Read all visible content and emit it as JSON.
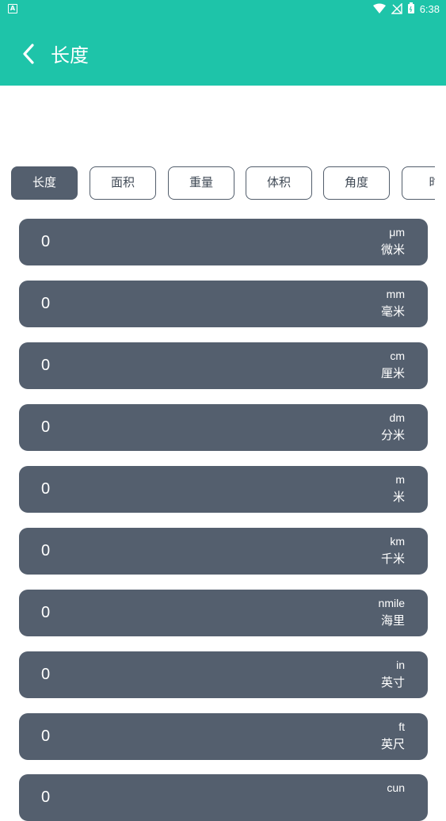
{
  "colors": {
    "accent": "#1ec4a9",
    "card": "#545f6e",
    "white": "#ffffff"
  },
  "status_bar": {
    "time": "6:38",
    "notification_icon": "a-icon",
    "icons": [
      "wifi-icon",
      "signal-off-icon",
      "battery-icon"
    ]
  },
  "header": {
    "title": "长度",
    "back_icon": "chevron-left-icon"
  },
  "tabs": [
    {
      "label": "长度",
      "active": true
    },
    {
      "label": "面积",
      "active": false
    },
    {
      "label": "重量",
      "active": false
    },
    {
      "label": "体积",
      "active": false
    },
    {
      "label": "角度",
      "active": false
    },
    {
      "label": "时",
      "active": false
    }
  ],
  "units": [
    {
      "value": "0",
      "symbol": "μm",
      "name": "微米"
    },
    {
      "value": "0",
      "symbol": "mm",
      "name": "毫米"
    },
    {
      "value": "0",
      "symbol": "cm",
      "name": "厘米"
    },
    {
      "value": "0",
      "symbol": "dm",
      "name": "分米"
    },
    {
      "value": "0",
      "symbol": "m",
      "name": "米"
    },
    {
      "value": "0",
      "symbol": "km",
      "name": "千米"
    },
    {
      "value": "0",
      "symbol": "nmile",
      "name": "海里"
    },
    {
      "value": "0",
      "symbol": "in",
      "name": "英寸"
    },
    {
      "value": "0",
      "symbol": "ft",
      "name": "英尺"
    },
    {
      "value": "0",
      "symbol": "cun",
      "name": ""
    }
  ]
}
